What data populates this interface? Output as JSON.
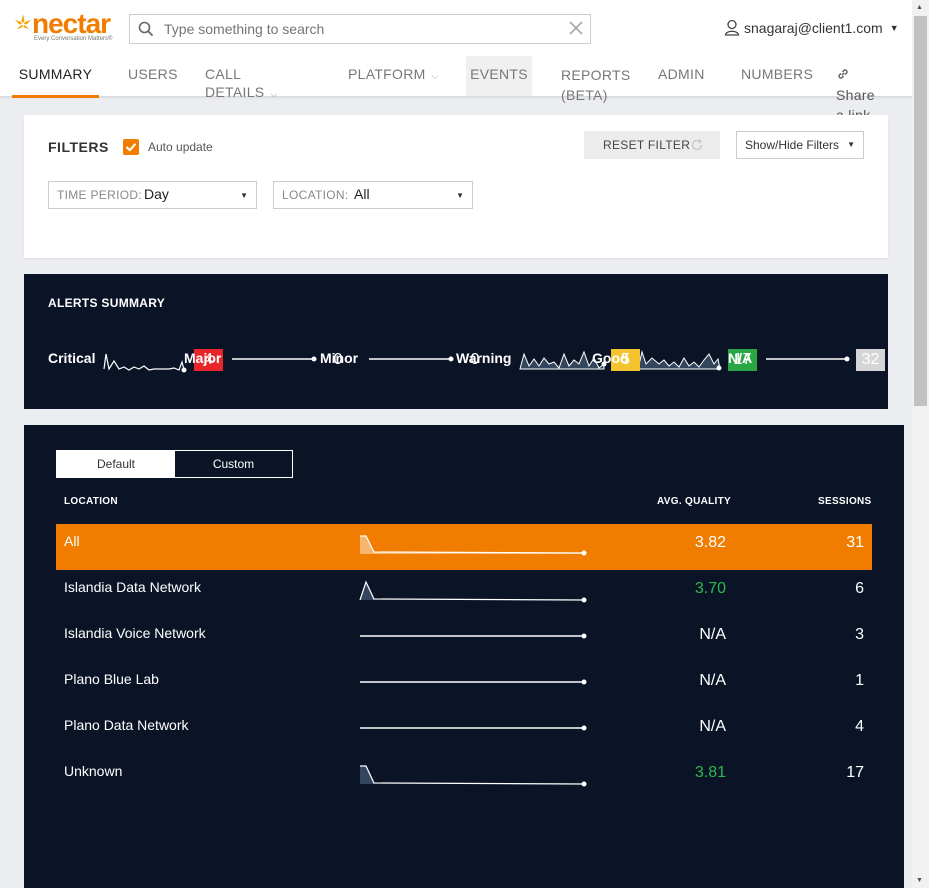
{
  "brand": {
    "name": "nectar",
    "tagline": "Every Conversation Matters®"
  },
  "search": {
    "placeholder": "Type something to search"
  },
  "user": {
    "email": "snagaraj@client1.com"
  },
  "nav": {
    "tabs": [
      {
        "label": "SUMMARY",
        "active": true
      },
      {
        "label": "USERS"
      },
      {
        "label": "CALL DETAILS"
      },
      {
        "label": "PLATFORM"
      },
      {
        "label": "EVENTS"
      },
      {
        "label": "REPORTS",
        "sub": "(BETA)"
      },
      {
        "label": "ADMIN"
      },
      {
        "label": "NUMBERS"
      },
      {
        "label": "Share",
        "sub": "a link"
      }
    ]
  },
  "filters": {
    "title": "FILTERS",
    "auto_update": {
      "label": "Auto update",
      "checked": true
    },
    "reset_label": "RESET FILTER",
    "show_hide_label": "Show/Hide Filters",
    "time_period": {
      "label": "TIME PERIOD:",
      "value": "Day"
    },
    "location": {
      "label": "LOCATION:",
      "value": "All"
    }
  },
  "alerts": {
    "title": "ALERTS SUMMARY",
    "items": [
      {
        "label": "Critical",
        "count": "4",
        "color": "#e8252b"
      },
      {
        "label": "Major",
        "count": "0",
        "color": "#0b1426"
      },
      {
        "label": "Minor",
        "count": "0",
        "color": "#0b1426"
      },
      {
        "label": "Warning",
        "count": "5",
        "color": "#f4c430"
      },
      {
        "label": "Good",
        "count": "17",
        "color": "#2aa745"
      },
      {
        "label": "N/A",
        "count": "32",
        "color": "#d6d6d6"
      }
    ]
  },
  "locations": {
    "toggle": {
      "default_label": "Default",
      "custom_label": "Custom",
      "selected": "Default"
    },
    "headers": {
      "location": "LOCATION",
      "avg_quality": "AVG. QUALITY",
      "sessions": "SESSIONS"
    },
    "rows": [
      {
        "name": "All",
        "avg_quality": "3.82",
        "sessions": "31",
        "selected": true,
        "quality_color": "#ffffff"
      },
      {
        "name": "Islandia Data Network",
        "avg_quality": "3.70",
        "sessions": "6",
        "quality_color": "#2db84d"
      },
      {
        "name": "Islandia Voice Network",
        "avg_quality": "N/A",
        "sessions": "3",
        "quality_color": "#ffffff"
      },
      {
        "name": "Plano Blue Lab",
        "avg_quality": "N/A",
        "sessions": "1",
        "quality_color": "#ffffff"
      },
      {
        "name": "Plano Data Network",
        "avg_quality": "N/A",
        "sessions": "4",
        "quality_color": "#ffffff"
      },
      {
        "name": "Unknown",
        "avg_quality": "3.81",
        "sessions": "17",
        "quality_color": "#2db84d"
      }
    ]
  },
  "colors": {
    "accent": "#f07c00",
    "panel": "#0b1426",
    "good": "#2db84d"
  }
}
